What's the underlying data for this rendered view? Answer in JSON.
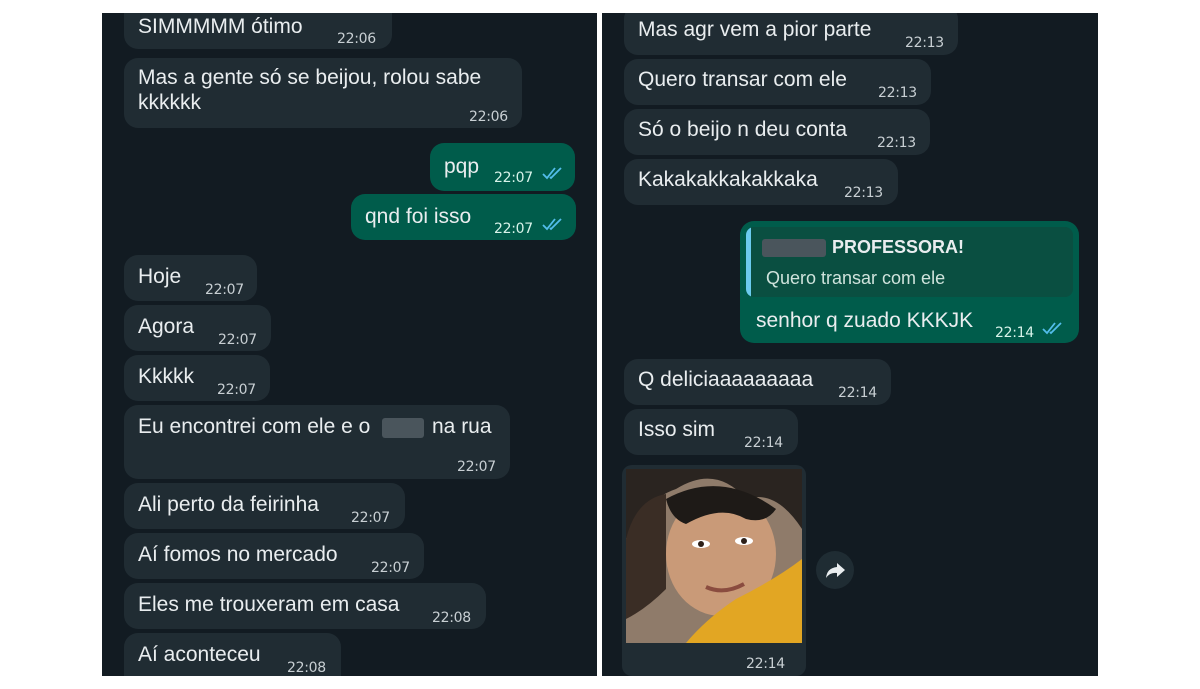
{
  "left_messages": [
    {
      "text": "SIMMMMM ótimo",
      "time": "22:06"
    },
    {
      "line1": "Mas a gente só se beijou, rolou sabe",
      "line2": "kkkkkk",
      "time": "22:06"
    },
    {
      "text": "pqp",
      "time": "22:07"
    },
    {
      "text": "qnd foi isso",
      "time": "22:07"
    },
    {
      "text": "Hoje",
      "time": "22:07"
    },
    {
      "text": "Agora",
      "time": "22:07"
    },
    {
      "text": "Kkkkk",
      "time": "22:07"
    },
    {
      "before": "Eu encontrei com ele e o",
      "after": "na rua",
      "time": "22:07"
    },
    {
      "text": "Ali perto da feirinha",
      "time": "22:07"
    },
    {
      "text": "Aí fomos no mercado",
      "time": "22:07"
    },
    {
      "text": "Eles me trouxeram em casa",
      "time": "22:08"
    },
    {
      "text": "Aí aconteceu",
      "time": "22:08"
    }
  ],
  "right_messages": [
    {
      "text": "Mas agr vem a pior parte",
      "time": "22:13"
    },
    {
      "text": "Quero transar com ele",
      "time": "22:13"
    },
    {
      "text": "Só o beijo n deu conta",
      "time": "22:13"
    },
    {
      "text": "Kakakakkakakkaka",
      "time": "22:13"
    },
    {
      "quote_author": "PROFESSORA!",
      "quote_text": "Quero transar com ele",
      "text": "senhor q zuado KKKJK",
      "time": "22:14"
    },
    {
      "text": "Q deliciaaaaaaaaa",
      "time": "22:14"
    },
    {
      "text": "Isso sim",
      "time": "22:14"
    },
    {
      "time": "22:14"
    }
  ],
  "icons": {
    "read_receipt": "double-check-icon",
    "forward": "forward-arrow-icon"
  },
  "colors": {
    "background": "#121b22",
    "incoming": "#202c33",
    "outgoing": "#005c4b",
    "tick": "#53bdeb"
  }
}
